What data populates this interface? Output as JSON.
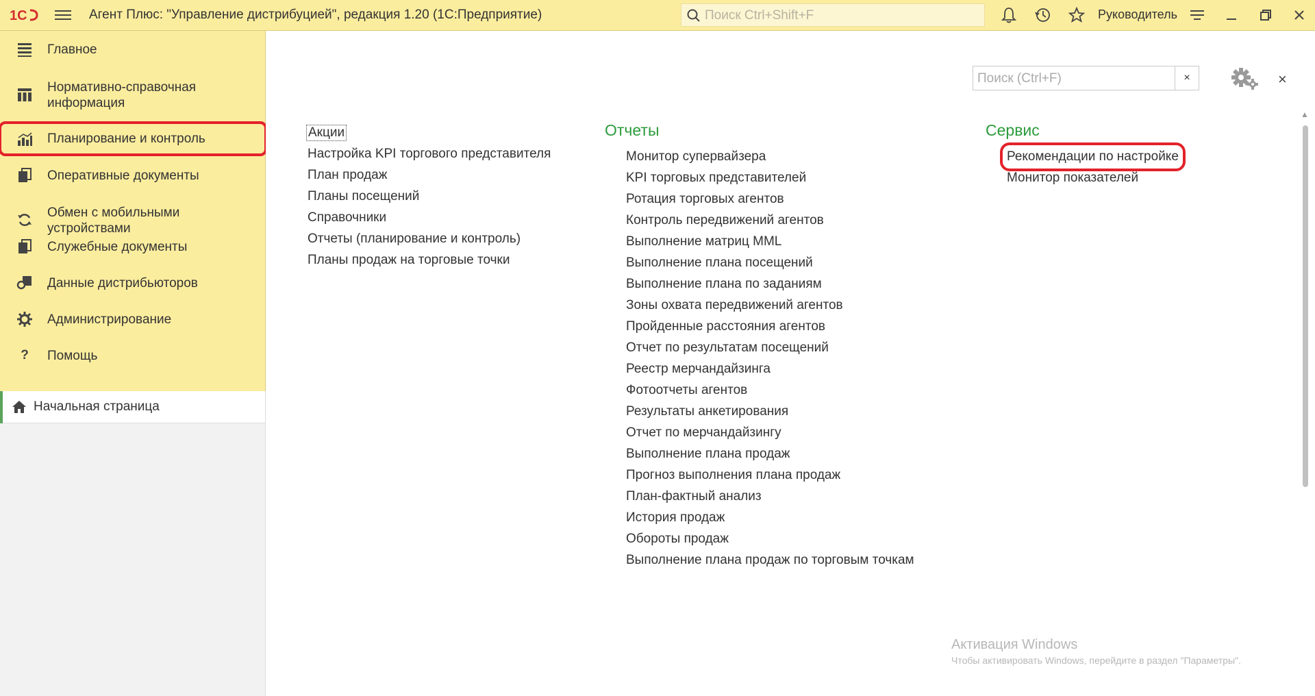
{
  "topbar": {
    "title": "Агент Плюс: \"Управление дистрибуцией\", редакция 1.20  (1С:Предприятие)",
    "search_placeholder": "Поиск Ctrl+Shift+F",
    "user": "Руководитель",
    "icons": [
      "logo-1c",
      "menu-icon",
      "search-icon",
      "bell-icon",
      "history-icon",
      "star-icon",
      "settings-lines-icon",
      "minimize-icon",
      "restore-icon",
      "close-icon"
    ]
  },
  "sidebar": {
    "items": [
      {
        "label": "Главное",
        "icon": "list-icon"
      },
      {
        "label": "Нормативно-справочная информация",
        "icon": "columns-icon"
      },
      {
        "label": "Планирование и контроль",
        "icon": "chart-icon",
        "active": true
      },
      {
        "label": "Оперативные документы",
        "icon": "documents-icon"
      },
      {
        "label": "Обмен с мобильными устройствами",
        "icon": "sync-icon"
      },
      {
        "label": "Служебные документы",
        "icon": "documents-icon"
      },
      {
        "label": "Данные дистрибьюторов",
        "icon": "distributor-icon"
      },
      {
        "label": "Администрирование",
        "icon": "gear-icon"
      },
      {
        "label": "Помощь",
        "icon": "help-icon"
      }
    ],
    "home": {
      "label": "Начальная страница",
      "icon": "home-icon"
    }
  },
  "panel": {
    "search_placeholder": "Поиск (Ctrl+F)",
    "clear": "×",
    "close": "×",
    "col1": {
      "links": [
        "Акции",
        "Настройка KPI торгового представителя",
        "План продаж",
        "Планы посещений",
        "Справочники",
        "Отчеты (планирование и контроль)",
        "Планы продаж на торговые точки"
      ]
    },
    "col2": {
      "heading": "Отчеты",
      "links": [
        "Монитор супервайзера",
        "KPI торговых представителей",
        "Ротация торговых агентов",
        "Контроль передвижений агентов",
        "Выполнение матриц MML",
        "Выполнение плана посещений",
        "Выполнение плана по заданиям",
        "Зоны охвата передвижений агентов",
        "Пройденные расстояния агентов",
        "Отчет по результатам посещений",
        "Реестр мерчандайзинга",
        "Фотоотчеты агентов",
        "Результаты анкетирования",
        "Отчет по  мерчандайзингу",
        "Выполнение плана продаж",
        "Прогноз выполнения плана продаж",
        "План-фактный анализ",
        "История продаж",
        "Обороты продаж",
        "Выполнение плана продаж по торговым точкам"
      ]
    },
    "col3": {
      "heading": "Сервис",
      "links": [
        "Рекомендации по настройке",
        "Монитор показателей"
      ]
    }
  },
  "watermark": {
    "line1": "Активация Windows",
    "line2": "Чтобы активировать Windows, перейдите в раздел \"Параметры\"."
  },
  "colors": {
    "accent_red": "#e3222a",
    "heading_green": "#2c9b3b",
    "panel_yellow": "#fbed9e"
  }
}
